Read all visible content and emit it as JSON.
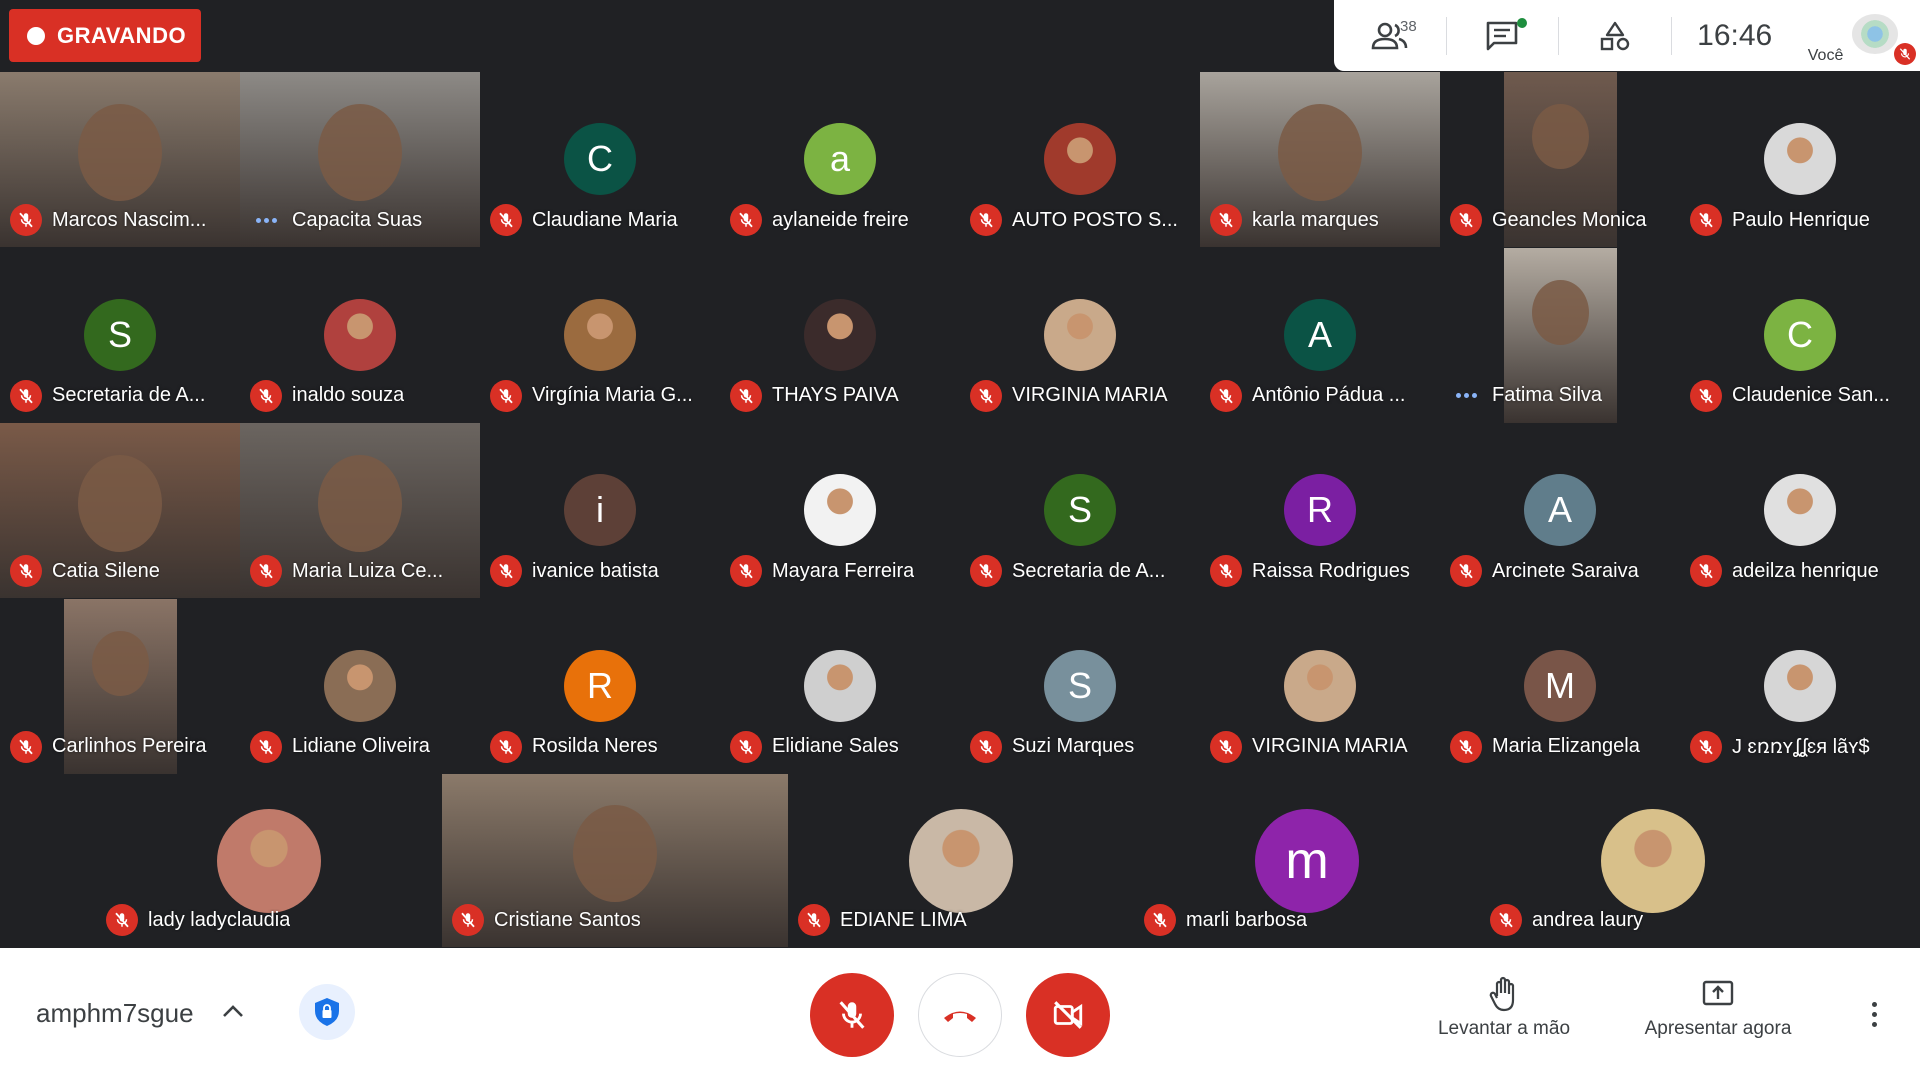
{
  "recording": {
    "label": "GRAVANDO"
  },
  "topbar": {
    "participants_count": "38",
    "clock": "16:46",
    "self_label": "Você"
  },
  "grid": [
    {
      "name": "Marcos Nascim...",
      "status": "muted",
      "kind": "video",
      "bg": "#8a7b6d"
    },
    {
      "name": "Capacita Suas",
      "status": "speaking",
      "kind": "video",
      "bg": "#8d8a86"
    },
    {
      "name": "Claudiane Maria",
      "status": "muted",
      "kind": "letter",
      "letter": "C",
      "color": "#0b5345"
    },
    {
      "name": "aylaneide freire",
      "status": "muted",
      "kind": "letter",
      "letter": "a",
      "color": "#7cb342"
    },
    {
      "name": "AUTO POSTO S...",
      "status": "muted",
      "kind": "photo",
      "color": "#a03a2c"
    },
    {
      "name": "karla marques",
      "status": "muted",
      "kind": "video",
      "bg": "#a8a39c"
    },
    {
      "name": "Geancles Monica",
      "status": "muted",
      "kind": "video-narrow",
      "bg": "#6f5a4e"
    },
    {
      "name": "Paulo Henrique",
      "status": "muted",
      "kind": "photo",
      "color": "#d9d9d9"
    },
    {
      "name": "Secretaria de A...",
      "status": "muted",
      "kind": "letter",
      "letter": "S",
      "color": "#33691e"
    },
    {
      "name": "inaldo souza",
      "status": "muted",
      "kind": "photo",
      "color": "#b0413e"
    },
    {
      "name": "Virgínia Maria G...",
      "status": "muted",
      "kind": "photo",
      "color": "#9b6b3f"
    },
    {
      "name": "THAYS PAIVA",
      "status": "muted",
      "kind": "photo",
      "color": "#3b2b2b"
    },
    {
      "name": "VIRGINIA MARIA",
      "status": "muted",
      "kind": "photo",
      "color": "#c9a98a"
    },
    {
      "name": "Antônio Pádua ...",
      "status": "muted",
      "kind": "letter",
      "letter": "A",
      "color": "#0b5345"
    },
    {
      "name": "Fatima Silva",
      "status": "speaking",
      "kind": "video-narrow",
      "bg": "#b4aca2"
    },
    {
      "name": "Claudenice San...",
      "status": "muted",
      "kind": "letter",
      "letter": "C",
      "color": "#7cb342"
    },
    {
      "name": "Catia Silene",
      "status": "muted",
      "kind": "video",
      "bg": "#7a5a48"
    },
    {
      "name": "Maria Luiza Ce...",
      "status": "muted",
      "kind": "video",
      "bg": "#6b6560"
    },
    {
      "name": "ivanice batista",
      "status": "muted",
      "kind": "letter",
      "letter": "i",
      "color": "#5d4037"
    },
    {
      "name": "Mayara Ferreira",
      "status": "muted",
      "kind": "photo",
      "color": "#f2f2f2"
    },
    {
      "name": "Secretaria de A...",
      "status": "muted",
      "kind": "letter",
      "letter": "S",
      "color": "#33691e"
    },
    {
      "name": "Raissa Rodrigues",
      "status": "muted",
      "kind": "letter",
      "letter": "R",
      "color": "#7b1fa2"
    },
    {
      "name": "Arcinete Saraiva",
      "status": "muted",
      "kind": "letter",
      "letter": "A",
      "color": "#607d8b"
    },
    {
      "name": "adeilza henrique",
      "status": "muted",
      "kind": "photo",
      "color": "#e0e0e0"
    },
    {
      "name": "Carlinhos Pereira",
      "status": "muted",
      "kind": "video-narrow",
      "bg": "#8a7466"
    },
    {
      "name": "Lidiane Oliveira",
      "status": "muted",
      "kind": "photo",
      "color": "#8a6d55"
    },
    {
      "name": "Rosilda Neres",
      "status": "muted",
      "kind": "letter",
      "letter": "R",
      "color": "#e8710a"
    },
    {
      "name": "Elidiane Sales",
      "status": "muted",
      "kind": "photo",
      "color": "#cfcfcf"
    },
    {
      "name": "Suzi Marques",
      "status": "muted",
      "kind": "letter",
      "letter": "S",
      "color": "#78909c"
    },
    {
      "name": "VIRGINIA MARIA",
      "status": "muted",
      "kind": "photo",
      "color": "#c9a98a"
    },
    {
      "name": "Maria Elizangela",
      "status": "muted",
      "kind": "letter",
      "letter": "M",
      "color": "#795548"
    },
    {
      "name": "J ɛռռʏʆʆɛя lãʏ$",
      "status": "muted",
      "kind": "photo",
      "color": "#d6d6d6"
    }
  ],
  "bottom_row": [
    {
      "name": "lady ladyclaudia",
      "kind": "photo",
      "color": "#c07a6a"
    },
    {
      "name": "Cristiane Santos",
      "kind": "video",
      "bg": "#8b7a6a"
    },
    {
      "name": "EDIANE LIMA",
      "kind": "photo",
      "color": "#c9b8a6"
    },
    {
      "name": "marli barbosa",
      "kind": "letter",
      "letter": "m",
      "color": "#8e24aa"
    },
    {
      "name": "andrea laury",
      "kind": "photo",
      "color": "#d8c08a"
    }
  ],
  "bottombar": {
    "meeting_code": "amphm7sgue",
    "raise_hand_label": "Levantar a mão",
    "present_label": "Apresentar agora"
  },
  "colors": {
    "red": "#d93025",
    "background": "#202124",
    "accent_blue": "#1a73e8"
  }
}
